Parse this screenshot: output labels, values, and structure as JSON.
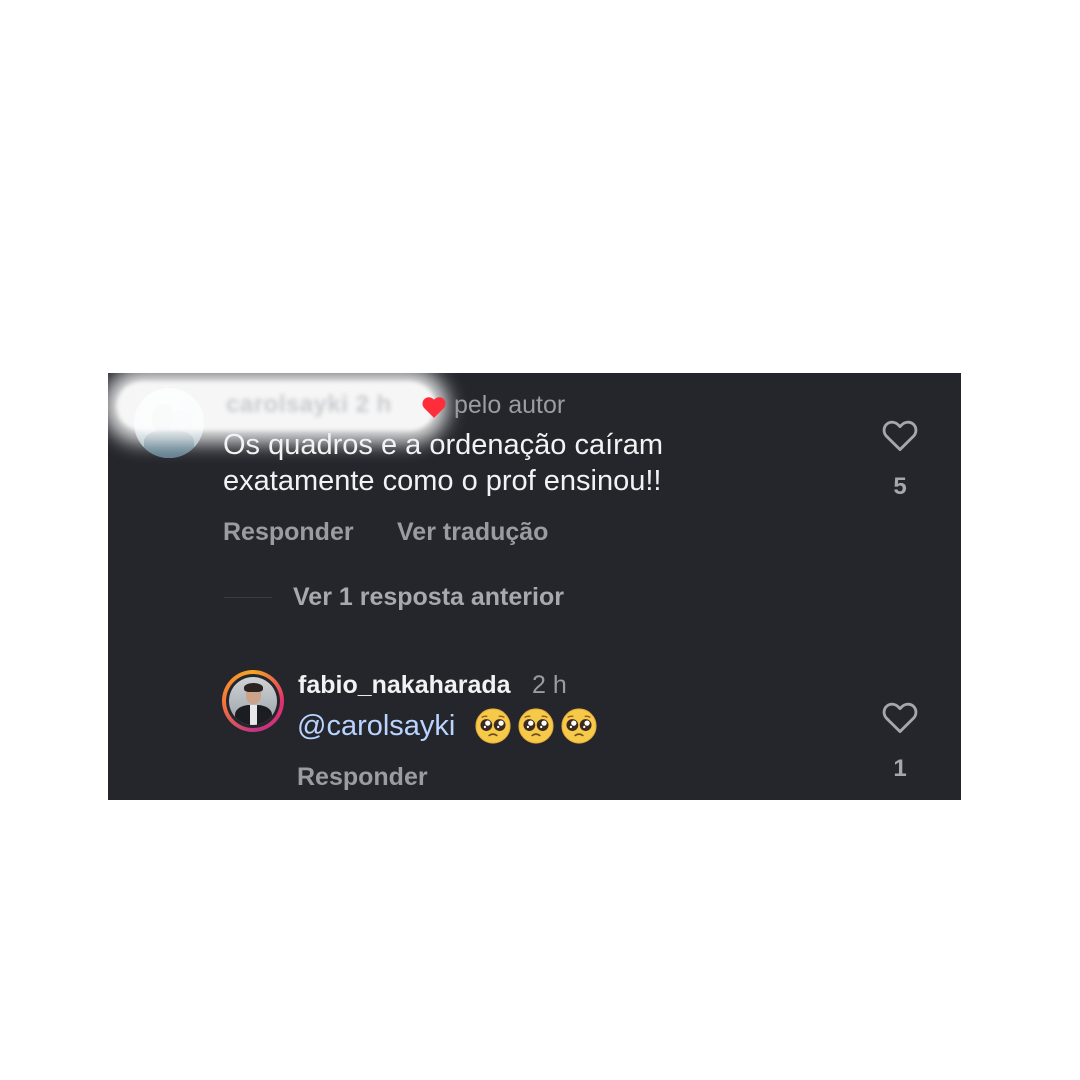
{
  "comment": {
    "username_blurred": "carolsayki",
    "time_blurred": "2 h",
    "liked_by_author_label": "pelo autor",
    "text": "Os quadros e a ordenação caíram exatamente como o prof ensinou!!",
    "reply_label": "Responder",
    "translate_label": "Ver tradução",
    "like_count": "5"
  },
  "more_replies_label": "Ver 1 resposta anterior",
  "reply": {
    "username": "fabio_nakaharada",
    "time": "2 h",
    "mention": "@carolsayki",
    "emojis": [
      "pleading-face",
      "pleading-face",
      "pleading-face"
    ],
    "reply_label": "Responder",
    "like_count": "1"
  },
  "colors": {
    "background": "#24262c",
    "heart_badge": "#ff2d3a",
    "mention": "#b9d4ff"
  }
}
